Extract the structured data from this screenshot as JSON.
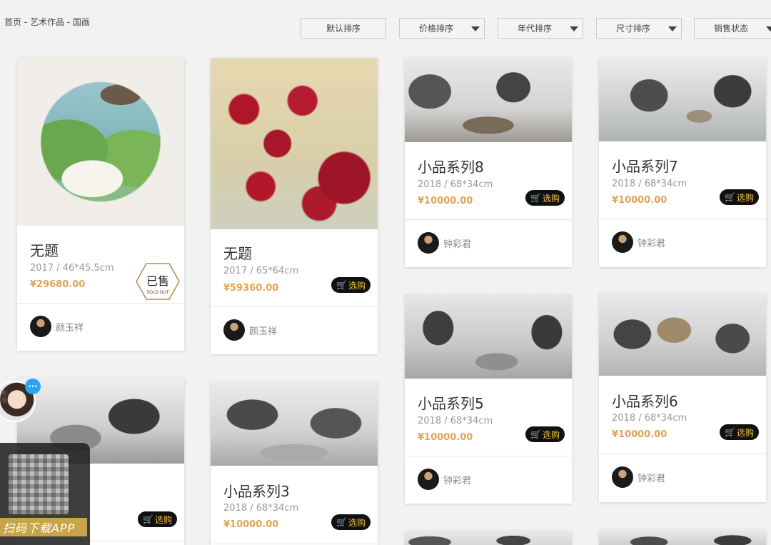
{
  "breadcrumb": "首页 - 艺术作品 - 国画",
  "sort": {
    "default": "默认排序",
    "price": "价格排序",
    "year": "年代排序",
    "size": "尺寸排序",
    "status": "销售状态"
  },
  "buy_label": "选购",
  "sold_label": "已售",
  "sold_sub": "SOLD OUT",
  "cards": [
    {
      "title": "无题",
      "spec": "2017 / 46*45.5cm",
      "price": "¥29680.00",
      "artist": "颜玉祥",
      "status": "sold"
    },
    {
      "title": "无题",
      "spec": "2017 / 65*64cm",
      "price": "¥59360.00",
      "artist": "颜玉祥",
      "status": "available"
    },
    {
      "title": "小品系列8",
      "spec": "2018 / 68*34cm",
      "price": "¥10000.00",
      "artist": "钟彩君",
      "status": "available"
    },
    {
      "title": "小品系列7",
      "spec": "2018 / 68*34cm",
      "price": "¥10000.00",
      "artist": "钟彩君",
      "status": "available"
    },
    {
      "title": "小品系列5",
      "spec": "2018 / 68*34cm",
      "price": "¥10000.00",
      "artist": "钟彩君",
      "status": "available"
    },
    {
      "title": "小品系列6",
      "spec": "2018 / 68*34cm",
      "price": "¥10000.00",
      "artist": "钟彩君",
      "status": "available"
    },
    {
      "title": "列4",
      "spec": "34cm",
      "price": "",
      "artist": "",
      "status": "available"
    },
    {
      "title": "小品系列3",
      "spec": "2018 / 68*34cm",
      "price": "¥10000.00",
      "artist": "",
      "status": "available"
    }
  ],
  "widgets": {
    "cs_label": "客服",
    "cs_bubble": "···",
    "qr_text": "扫码下载APP"
  },
  "colors": {
    "price": "#e0a458",
    "buy_bg": "#111111",
    "buy_text": "#f0c040"
  }
}
